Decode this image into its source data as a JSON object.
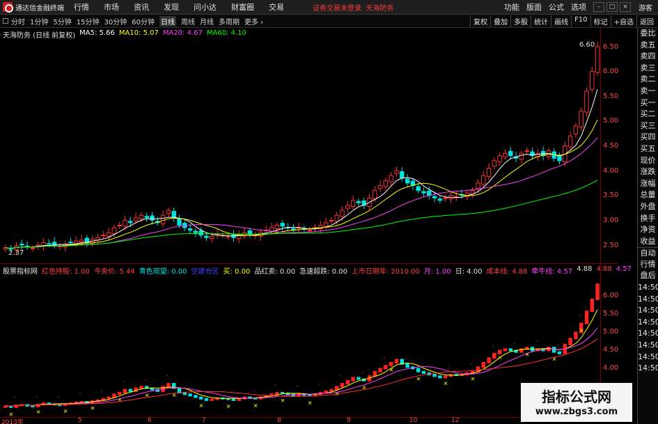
{
  "app": {
    "title": "通达信金融终端",
    "login_hint": "证券交易未登录",
    "stock_tag": "天海防务",
    "guest": "游客"
  },
  "menu": [
    "行情",
    "市场",
    "资讯",
    "发现",
    "问小达",
    "财富圈",
    "交易"
  ],
  "menu_right": [
    "功能",
    "版面",
    "公式",
    "选项"
  ],
  "periods": [
    "分时",
    "1分钟",
    "5分钟",
    "15分钟",
    "30分钟",
    "60分钟",
    "日线",
    "周线",
    "月线",
    "多周期",
    "更多"
  ],
  "active_period": "日线",
  "toolbar": [
    "复权",
    "叠加",
    "多股",
    "统计",
    "画线",
    "F10",
    "标记",
    "+自选",
    "返回"
  ],
  "main_info": {
    "stock": "天海防务 (日线 前复权)",
    "ma5": "MA5: 5.66",
    "ma10": "MA10: 5.07",
    "ma20": "MA20: 4.67",
    "ma60": "MA60: 4.10",
    "high_flag": "6.60",
    "low_flag": "2.37",
    "colors": {
      "ma5": "#ffffff",
      "ma10": "#ffff00",
      "ma20": "#ff40ff",
      "ma60": "#00ff00"
    }
  },
  "main_axis": [
    "6.50",
    "6.00",
    "5.50",
    "5.00",
    "4.50",
    "4.00",
    "3.50",
    "3.00",
    "2.50"
  ],
  "sub_info": [
    {
      "text": "股票指标网",
      "color": "#e0e0e0"
    },
    {
      "text": "红色持股: 1.00",
      "color": "#ff4040"
    },
    {
      "text": "今卖价: 5.44",
      "color": "#ff4040"
    },
    {
      "text": "青色观望: 0.00",
      "color": "#00e5e5"
    },
    {
      "text": "空建仓区",
      "color": "#4040ff"
    },
    {
      "text": "买: 0.00",
      "color": "#ffff00"
    },
    {
      "text": "品红卖: 0.00",
      "color": "#e0e0e0"
    },
    {
      "text": "急速超跌: 0.00",
      "color": "#e0e0e0"
    },
    {
      "text": "上市日期年: 2010.00",
      "color": "#ff4040"
    },
    {
      "text": "月: 1.00",
      "color": "#ff40ff"
    },
    {
      "text": "日: 4.00",
      "color": "#e0e0e0"
    },
    {
      "text": "成本线: 4.88",
      "color": "#ff4040"
    },
    {
      "text": "牵牛线: 4.57",
      "color": "#ff40ff"
    },
    {
      "text": "4.88",
      "color": "#e0e0e0"
    },
    {
      "text": "4.88",
      "color": "#ff4040"
    },
    {
      "text": "4.57",
      "color": "#ff40ff"
    }
  ],
  "sub_axis": [
    "6.00",
    "5.50",
    "5.00",
    "4.50",
    "4.00"
  ],
  "side_panel": [
    "委比",
    "卖五",
    "卖四",
    "卖三",
    "卖二",
    "卖一",
    "买一",
    "买二",
    "买三",
    "买四",
    "买五",
    "现价",
    "涨跌",
    "涨幅",
    "总量",
    "外盘",
    "换手",
    "净资",
    "收益",
    "自动",
    "行情",
    "盘后",
    "14:50",
    "14:50",
    "14:50",
    "14:50",
    "14:50",
    "14:50",
    "14:50",
    "14:50"
  ],
  "time_axis": [
    "2013年",
    "5",
    "6",
    "7",
    "8",
    "9",
    "10",
    "12"
  ],
  "watermark": {
    "title": "指标公式网",
    "url": "www.zbgs3.com"
  },
  "chart_data": {
    "type": "candlestick",
    "price_range": [
      2.3,
      6.75
    ],
    "closes": [
      2.45,
      2.42,
      2.48,
      2.5,
      2.46,
      2.44,
      2.5,
      2.55,
      2.52,
      2.5,
      2.48,
      2.52,
      2.55,
      2.58,
      2.6,
      2.55,
      2.62,
      2.65,
      2.7,
      2.75,
      2.85,
      2.9,
      3.0,
      2.95,
      3.05,
      3.1,
      3.05,
      3.0,
      2.95,
      3.1,
      3.2,
      3.05,
      2.9,
      2.85,
      2.8,
      2.75,
      2.7,
      2.65,
      2.68,
      2.72,
      2.7,
      2.68,
      2.65,
      2.7,
      2.75,
      2.72,
      2.7,
      2.75,
      2.8,
      2.85,
      2.9,
      2.88,
      2.85,
      2.8,
      2.85,
      2.82,
      2.8,
      2.85,
      2.9,
      2.95,
      3.0,
      3.1,
      3.2,
      3.3,
      3.4,
      3.35,
      3.3,
      3.45,
      3.6,
      3.7,
      3.8,
      3.9,
      4.0,
      3.85,
      3.75,
      3.7,
      3.6,
      3.55,
      3.5,
      3.45,
      3.4,
      3.45,
      3.5,
      3.48,
      3.5,
      3.55,
      3.6,
      3.75,
      3.9,
      4.05,
      4.2,
      4.3,
      4.35,
      4.3,
      4.25,
      4.35,
      4.4,
      4.3,
      4.35,
      4.3,
      4.4,
      4.25,
      4.2,
      4.5,
      4.7,
      4.9,
      5.2,
      5.6,
      6.0,
      6.5
    ]
  }
}
